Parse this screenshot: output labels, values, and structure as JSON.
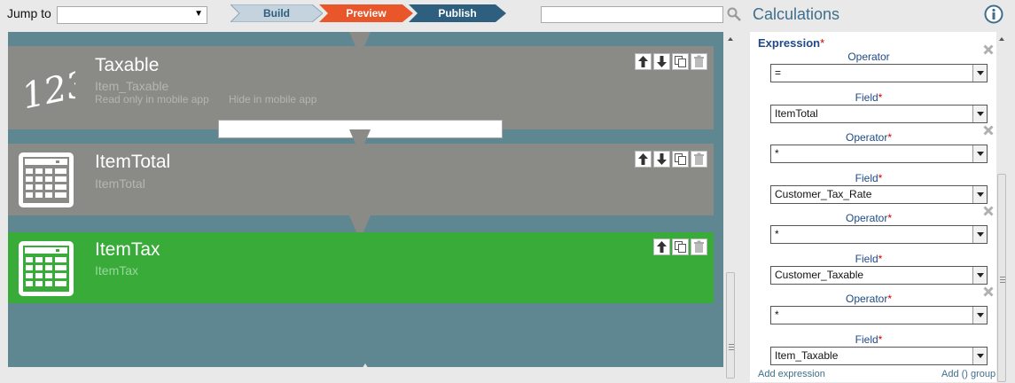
{
  "topbar": {
    "jump_label": "Jump to",
    "jump_value": "",
    "search_value": "",
    "steps": [
      {
        "label": "Build",
        "state": "done"
      },
      {
        "label": "Preview",
        "state": "active"
      },
      {
        "label": "Publish",
        "state": "todo"
      }
    ]
  },
  "cards": [
    {
      "title": "Taxable",
      "subtitle": "Item_Taxable",
      "icon": "number-123-icon",
      "readonly_hint": "Read only in mobile app",
      "hide_label": "Hide in mobile app",
      "hide_value": ""
    },
    {
      "title": "ItemTotal",
      "subtitle": "ItemTotal",
      "icon": "calculator-icon"
    },
    {
      "title": "ItemTax",
      "subtitle": "ItemTax",
      "icon": "calculator-icon",
      "selected": true
    }
  ],
  "panel": {
    "title": "Calculations",
    "expression_label": "Expression",
    "required_mark": "*",
    "rows": [
      {
        "label": "Operator",
        "value": "=",
        "required": false,
        "removable": true
      },
      {
        "label": "Field",
        "value": "ItemTotal",
        "required": true,
        "removable": false
      },
      {
        "label": "Operator",
        "value": "*",
        "required": true,
        "removable": true
      },
      {
        "label": "Field",
        "value": "Customer_Tax_Rate",
        "required": true,
        "removable": false
      },
      {
        "label": "Operator",
        "value": "*",
        "required": true,
        "removable": true
      },
      {
        "label": "Field",
        "value": "Customer_Taxable",
        "required": true,
        "removable": false
      },
      {
        "label": "Operator",
        "value": "*",
        "required": true,
        "removable": true
      },
      {
        "label": "Field",
        "value": "Item_Taxable",
        "required": true,
        "removable": false
      }
    ],
    "add_expression": "Add expression",
    "add_group": "Add () group"
  },
  "colors": {
    "accent": "#3e6f8d",
    "card_gray": "#8a8a86",
    "card_selected": "#38ab39",
    "canvas_bg": "#5e8792",
    "step_done": "#c4d3dd",
    "step_active": "#e8562a",
    "step_todo": "#2f5f7e"
  }
}
